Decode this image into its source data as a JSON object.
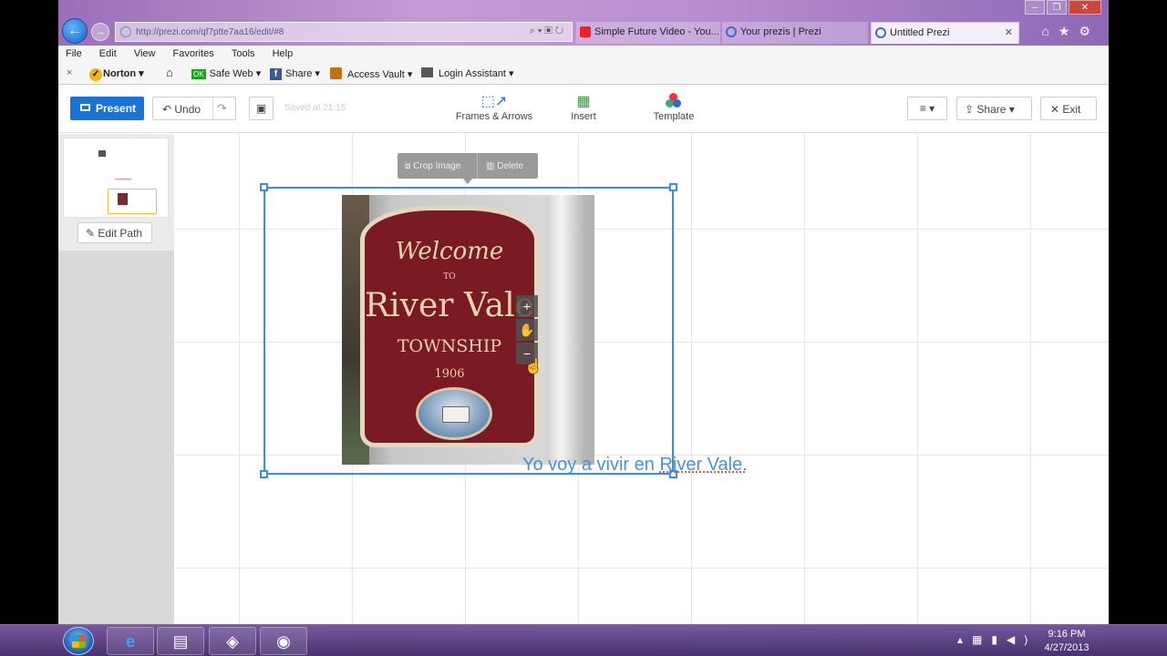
{
  "browser": {
    "url": "http://prezi.com/qf7ptte7aa16/edit/#8",
    "tabs": [
      {
        "label": "Simple Future Video - You..."
      },
      {
        "label": "Your prezis | Prezi"
      },
      {
        "label": "Untitled Prezi"
      }
    ],
    "menu": [
      "File",
      "Edit",
      "View",
      "Favorites",
      "Tools",
      "Help"
    ],
    "norton": {
      "close": "×",
      "brand": "Norton",
      "safe_web": "Safe Web",
      "share": "Share",
      "access_vault": "Access Vault",
      "login_assistant": "Login Assistant"
    }
  },
  "prezi": {
    "toolbar": {
      "present": "Present",
      "undo": "Undo",
      "saved": "Saved at 21:15",
      "frames": "Frames & Arrows",
      "insert": "Insert",
      "template": "Template",
      "share": "Share",
      "exit": "Exit"
    },
    "sidebar": {
      "edit_path": "Edit Path"
    },
    "canvas": {
      "crop": "Crop Image",
      "delete": "Delete",
      "caption_prefix": "Yo voy a vivir en ",
      "caption_place": "River Vale.",
      "sign": {
        "welcome": "Welcome",
        "to": "TO",
        "town": "River Vale",
        "ship": "TOWNSHIP",
        "year": "1906"
      }
    }
  },
  "taskbar": {
    "time": "9:16 PM",
    "date": "4/27/2013"
  },
  "colors": {
    "prezi_blue": "#1a74d6",
    "selection_blue": "#3a8ee6",
    "caption_blue": "#4a90d9"
  }
}
